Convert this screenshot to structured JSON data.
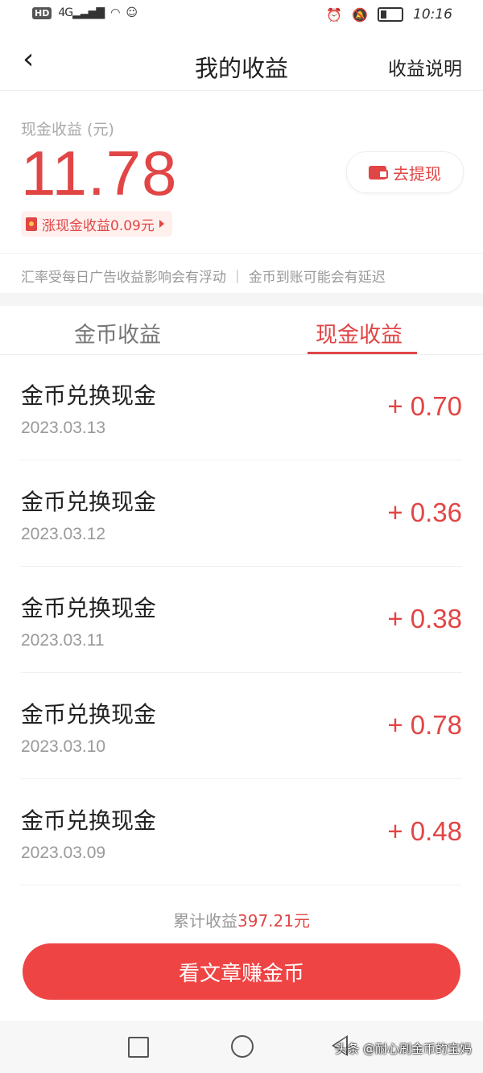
{
  "status_bar": {
    "hd": "HD",
    "network": "4G",
    "time": "10:16"
  },
  "header": {
    "back_icon": "chevron-left-icon",
    "title": "我的收益",
    "help_label": "收益说明"
  },
  "summary": {
    "label": "现金收益 (元)",
    "amount": "11.78",
    "withdraw_label": "去提现",
    "promo_text": "涨现金收益0.09元",
    "notice": "汇率受每日广告收益影响会有浮动 ｜ 金币到账可能会有延迟"
  },
  "tabs": [
    {
      "label": "金币收益",
      "active": false
    },
    {
      "label": "现金收益",
      "active": true
    }
  ],
  "records": [
    {
      "title": "金币兑换现金",
      "date": "2023.03.13",
      "amount": "+ 0.70"
    },
    {
      "title": "金币兑换现金",
      "date": "2023.03.12",
      "amount": "+ 0.36"
    },
    {
      "title": "金币兑换现金",
      "date": "2023.03.11",
      "amount": "+ 0.38"
    },
    {
      "title": "金币兑换现金",
      "date": "2023.03.10",
      "amount": "+ 0.78"
    },
    {
      "title": "金币兑换现金",
      "date": "2023.03.09",
      "amount": "+ 0.48"
    }
  ],
  "footer": {
    "total_label": "累计收益",
    "total_value": "397.21元",
    "cta_label": "看文章赚金币"
  },
  "watermark": "头条 @耐心刷金币的宝妈",
  "colors": {
    "accent": "#e14545",
    "button": "#ef4444"
  }
}
